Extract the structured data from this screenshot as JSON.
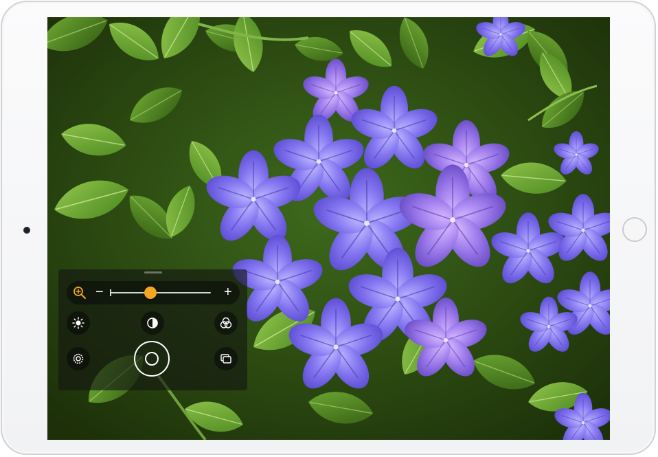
{
  "app": {
    "name": "Magnifier"
  },
  "zoom": {
    "minus_label": "−",
    "plus_label": "+",
    "level": 0.4,
    "accent_color": "#f4a623"
  },
  "controls": {
    "brightness": {
      "icon": "sun-icon"
    },
    "contrast": {
      "icon": "contrast-icon"
    },
    "filters": {
      "icon": "color-filters-icon"
    },
    "settings": {
      "icon": "gear-icon"
    },
    "freeze": {
      "icon": "shutter-icon"
    },
    "multi_image": {
      "icon": "multi-image-icon"
    }
  }
}
